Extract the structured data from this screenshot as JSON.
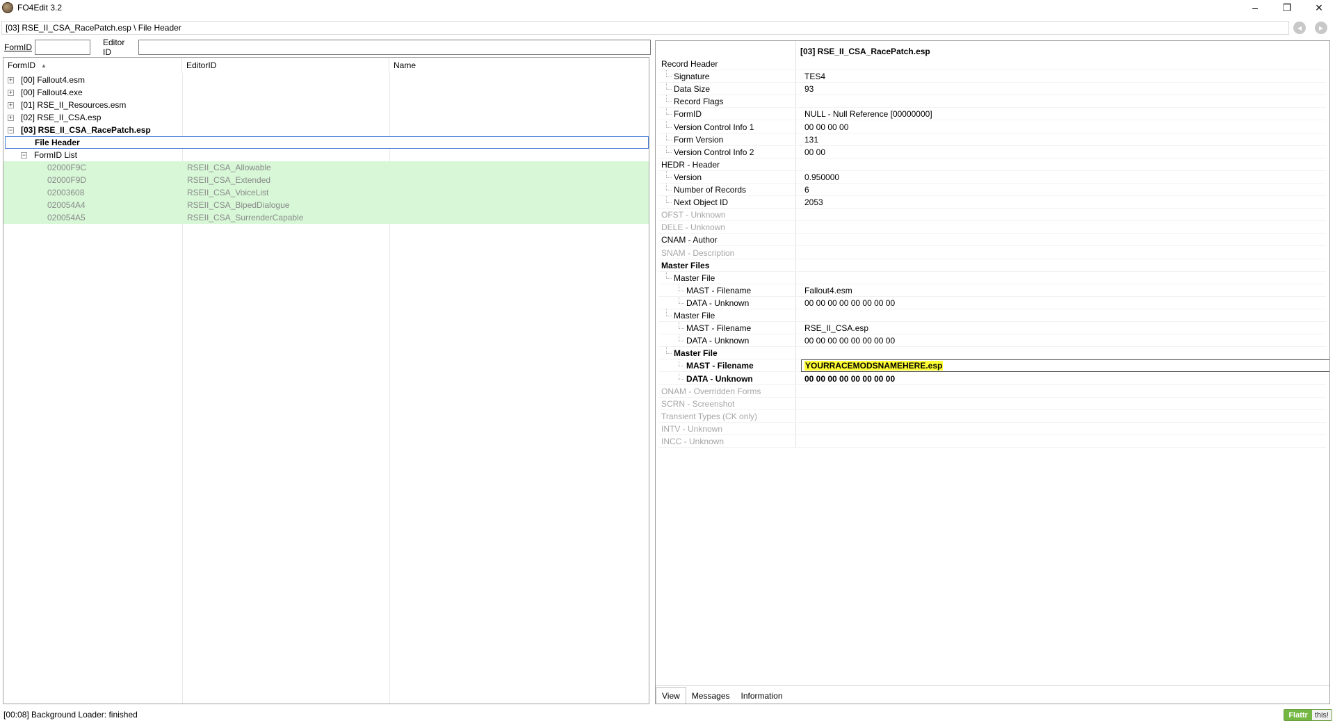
{
  "window": {
    "title": "FO4Edit 3.2",
    "minimize_glyph": "–",
    "maximize_glyph": "❐",
    "close_glyph": "✕"
  },
  "pathbar": {
    "path": "[03] RSE_II_CSA_RacePatch.esp \\ File Header",
    "back_glyph": "◂",
    "forward_glyph": "▸"
  },
  "filter": {
    "formid_label": "FormID",
    "formid_value": "",
    "editorid_label": "Editor ID",
    "editorid_value": ""
  },
  "tree": {
    "columns": [
      "FormID",
      "EditorID",
      "Name"
    ],
    "sort_glyph": "▲",
    "files": [
      {
        "label": "[00] Fallout4.esm",
        "expander": "+"
      },
      {
        "label": "[00] Fallout4.exe",
        "expander": "+"
      },
      {
        "label": "[01] RSE_II_Resources.esm",
        "expander": "+"
      },
      {
        "label": "[02] RSE_II_CSA.esp",
        "expander": "+"
      },
      {
        "label": "[03] RSE_II_CSA_RacePatch.esp",
        "expander": "−"
      }
    ],
    "file_header_label": "File Header",
    "formid_list": {
      "label": "FormID List",
      "expander": "−"
    },
    "records": [
      {
        "formid": "02000F9C",
        "editorid": "RSEII_CSA_Allowable"
      },
      {
        "formid": "02000F9D",
        "editorid": "RSEII_CSA_Extended"
      },
      {
        "formid": "02003608",
        "editorid": "RSEII_CSA_VoiceList"
      },
      {
        "formid": "020054A4",
        "editorid": "RSEII_CSA_BipedDialogue"
      },
      {
        "formid": "020054A5",
        "editorid": "RSEII_CSA_SurrenderCapable"
      }
    ]
  },
  "record_view": {
    "header_title": "[03] RSE_II_CSA_RacePatch.esp",
    "rows": [
      {
        "name": "Record Header",
        "value": ""
      },
      {
        "name": "Signature",
        "value": "TES4"
      },
      {
        "name": "Data Size",
        "value": "93"
      },
      {
        "name": "Record Flags",
        "value": ""
      },
      {
        "name": "FormID",
        "value": "NULL - Null Reference [00000000]"
      },
      {
        "name": "Version Control Info 1",
        "value": "00 00 00 00"
      },
      {
        "name": "Form Version",
        "value": "131"
      },
      {
        "name": "Version Control Info 2",
        "value": "00 00"
      },
      {
        "name": "HEDR - Header",
        "value": ""
      },
      {
        "name": "Version",
        "value": "0.950000"
      },
      {
        "name": "Number of Records",
        "value": "6"
      },
      {
        "name": "Next Object ID",
        "value": "2053"
      },
      {
        "name": "OFST - Unknown",
        "value": ""
      },
      {
        "name": "DELE - Unknown",
        "value": ""
      },
      {
        "name": "CNAM - Author",
        "value": ""
      },
      {
        "name": "SNAM - Description",
        "value": ""
      },
      {
        "name": "Master Files",
        "value": ""
      },
      {
        "name": "Master File",
        "value": ""
      },
      {
        "name": "MAST - Filename",
        "value": "Fallout4.esm"
      },
      {
        "name": "DATA - Unknown",
        "value": "00 00 00 00 00 00 00 00"
      },
      {
        "name": "Master File",
        "value": ""
      },
      {
        "name": "MAST - Filename",
        "value": "RSE_II_CSA.esp"
      },
      {
        "name": "DATA - Unknown",
        "value": "00 00 00 00 00 00 00 00"
      },
      {
        "name": "Master File",
        "value": ""
      },
      {
        "name": "MAST - Filename",
        "value": "YOURRACEMODSNAMEHERE.esp"
      },
      {
        "name": "DATA - Unknown",
        "value": "00 00 00 00 00 00 00 00"
      },
      {
        "name": "ONAM - Overridden Forms",
        "value": ""
      },
      {
        "name": "SCRN - Screenshot",
        "value": ""
      },
      {
        "name": "Transient Types (CK only)",
        "value": ""
      },
      {
        "name": "INTV - Unknown",
        "value": ""
      },
      {
        "name": "INCC - Unknown",
        "value": ""
      }
    ],
    "tabs": [
      "View",
      "Messages",
      "Information"
    ],
    "highlight_color": "#ffff33"
  },
  "status": {
    "text": "[00:08] Background Loader: finished",
    "flattr_label": "Flattr",
    "flattr_this": "this!"
  }
}
